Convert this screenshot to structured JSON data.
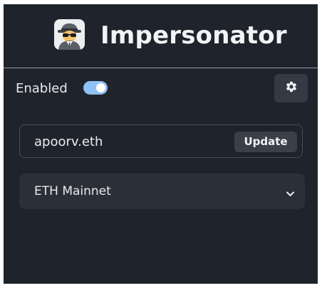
{
  "header": {
    "title": "Impersonator",
    "logo_icon": "spy-icon"
  },
  "toolbar": {
    "enabled_label": "Enabled",
    "enabled": true,
    "settings_icon": "gear-icon"
  },
  "address": {
    "value": "apoorv.eth",
    "update_label": "Update"
  },
  "network": {
    "selected": "ETH Mainnet",
    "dropdown_icon": "chevron-down-icon"
  },
  "colors": {
    "background": "#1f232b",
    "toggle_on": "#8fc2f4",
    "button": "#343a44"
  }
}
